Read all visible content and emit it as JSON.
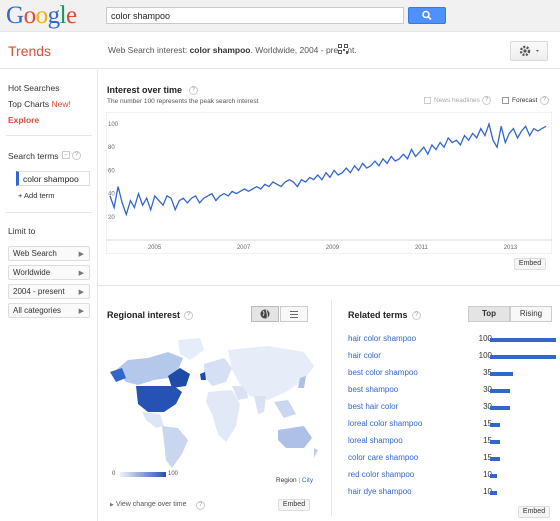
{
  "header": {
    "logo_letters": [
      {
        "ch": "G",
        "color": "#3366cc"
      },
      {
        "ch": "o",
        "color": "#dd4b39"
      },
      {
        "ch": "o",
        "color": "#f4b400"
      },
      {
        "ch": "g",
        "color": "#3366cc"
      },
      {
        "ch": "l",
        "color": "#0f9d58"
      },
      {
        "ch": "e",
        "color": "#dd4b39"
      }
    ],
    "search_value": "color shampoo"
  },
  "subbar": {
    "title": "Trends",
    "desc_prefix": "Web Search interest: ",
    "desc_term": "color shampoo",
    "desc_suffix": ". Worldwide, 2004 - present."
  },
  "sidebar": {
    "hot_searches": "Hot Searches",
    "top_charts": "Top Charts",
    "new_badge": "New!",
    "explore": "Explore",
    "search_terms_heading": "Search terms",
    "term": "color shampoo",
    "add_term": "+ Add term",
    "limit_heading": "Limit to",
    "limits": [
      "Web Search",
      "Worldwide",
      "2004 - present",
      "All categories"
    ]
  },
  "interest": {
    "title": "Interest over time",
    "subtitle": "The number 100 represents the peak search interest",
    "news_headlines": "News headlines",
    "forecast": "Forecast",
    "embed": "Embed"
  },
  "chart_data": {
    "type": "line",
    "title": "Interest over time",
    "xlabel": "",
    "ylabel": "",
    "ylim": [
      0,
      100
    ],
    "yticks": [
      20,
      40,
      60,
      80,
      100
    ],
    "xticks": [
      "2005",
      "2007",
      "2009",
      "2011",
      "2013"
    ],
    "grid": false,
    "legend": "none",
    "series": [
      {
        "values": [
          38,
          28,
          46,
          32,
          22,
          34,
          28,
          40,
          30,
          36,
          26,
          38,
          34,
          30,
          38,
          36,
          26,
          34,
          36,
          32,
          36,
          38,
          32,
          36,
          38,
          40,
          34,
          38,
          40,
          38,
          42,
          40,
          42,
          44,
          42,
          44,
          46,
          44,
          48,
          46,
          50,
          48,
          46,
          50,
          52,
          50,
          46,
          52,
          50,
          54,
          52,
          56,
          52,
          58,
          54,
          60,
          56,
          58,
          62,
          58,
          64,
          60,
          66,
          62,
          64,
          68,
          64,
          70,
          66,
          72,
          68,
          70,
          74,
          70,
          78,
          72,
          76,
          80,
          74,
          82,
          78,
          84,
          80,
          88,
          84,
          86,
          82,
          90,
          86,
          92,
          88,
          96,
          90,
          100,
          86,
          80,
          98,
          84,
          92,
          96,
          88,
          94,
          98,
          90,
          96,
          94,
          96,
          98
        ]
      }
    ]
  },
  "regional": {
    "title": "Regional interest",
    "legend_min": "0",
    "legend_max": "100",
    "region_link": "Region",
    "city_link": "City",
    "view_change": "View change over time",
    "embed": "Embed"
  },
  "related": {
    "title": "Related terms",
    "tab_top": "Top",
    "tab_rising": "Rising",
    "rows": [
      {
        "term": "hair color shampoo",
        "value": 100
      },
      {
        "term": "hair color",
        "value": 100
      },
      {
        "term": "best color shampoo",
        "value": 35
      },
      {
        "term": "best shampoo",
        "value": 30
      },
      {
        "term": "best hair color",
        "value": 30
      },
      {
        "term": "loreal color shampoo",
        "value": 15
      },
      {
        "term": "loreal shampoo",
        "value": 15
      },
      {
        "term": "color care shampoo",
        "value": 15
      },
      {
        "term": "red color shampoo",
        "value": 10
      },
      {
        "term": "hair dye shampoo",
        "value": 10
      }
    ],
    "embed": "Embed"
  }
}
